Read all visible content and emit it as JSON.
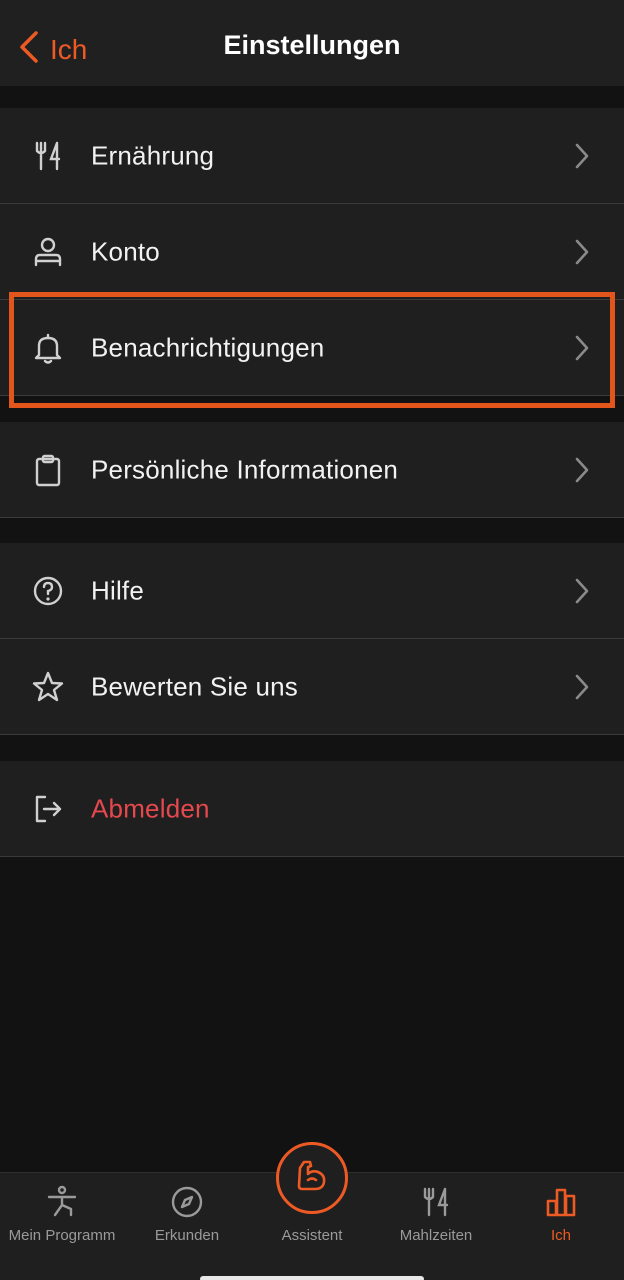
{
  "nav": {
    "back_label": "Ich",
    "title": "Einstellungen"
  },
  "groups": [
    {
      "items": [
        {
          "label": "Ernährung",
          "icon": "fork-knife-icon"
        },
        {
          "label": "Konto",
          "icon": "person-icon"
        },
        {
          "label": "Benachrichtigungen",
          "icon": "bell-icon"
        }
      ]
    },
    {
      "items": [
        {
          "label": "Persönliche Informationen",
          "icon": "clipboard-icon"
        }
      ]
    },
    {
      "items": [
        {
          "label": "Hilfe",
          "icon": "help-circle-icon"
        },
        {
          "label": "Bewerten Sie uns",
          "icon": "star-icon"
        }
      ]
    },
    {
      "items": [
        {
          "label": "Abmelden",
          "icon": "logout-icon"
        }
      ]
    }
  ],
  "tabbar": {
    "tabs": [
      {
        "label": "Mein Programm",
        "icon": "exercise-figure-icon"
      },
      {
        "label": "Erkunden",
        "icon": "compass-icon"
      },
      {
        "label": "Assistent",
        "icon": "flexed-arm-icon"
      },
      {
        "label": "Mahlzeiten",
        "icon": "fork-knife-icon"
      },
      {
        "label": "Ich",
        "icon": "bar-chart-icon"
      }
    ],
    "active": "Ich"
  },
  "colors": {
    "accent": "#ee5a24",
    "danger": "#e5484d",
    "background": "#121212",
    "surface": "#1f1f1f"
  }
}
